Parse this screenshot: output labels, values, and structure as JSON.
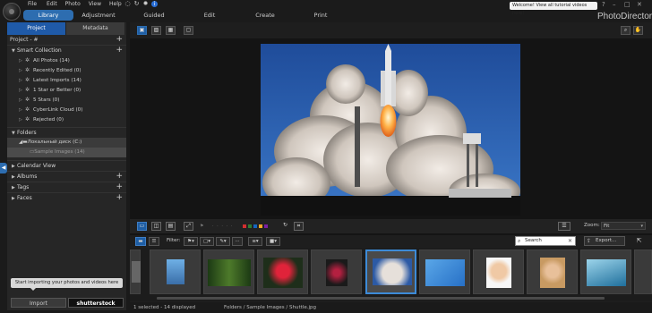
{
  "app": {
    "brand": "PhotoDirector",
    "welcome": "Welcome! View all tutorial videos here!"
  },
  "menu": [
    "File",
    "Edit",
    "Photo",
    "View",
    "Help"
  ],
  "modes": [
    {
      "label": "Library",
      "active": true
    },
    {
      "label": "Adjustment",
      "active": false
    },
    {
      "label": "Guided",
      "active": false
    },
    {
      "label": "Edit",
      "active": false
    },
    {
      "label": "Create",
      "active": false
    },
    {
      "label": "Print",
      "active": false
    }
  ],
  "sidebar": {
    "tabs": [
      {
        "label": "Project",
        "active": true
      },
      {
        "label": "Metadata",
        "active": false
      }
    ],
    "project": "Project - #",
    "smart_collection": {
      "title": "Smart Collection",
      "items": [
        "All Photos (14)",
        "Recently Edited (0)",
        "Latest Imports (14)",
        "1 Star or Better (0)",
        "5 Stars (0)",
        "CyberLink Cloud (0)",
        "Rejected (0)"
      ]
    },
    "folders": {
      "title": "Folders",
      "drive": "Локальный диск (C:)",
      "subfolder": "Sample Images (14)"
    },
    "sections": [
      "Calendar View",
      "Albums",
      "Tags",
      "Faces"
    ],
    "tooltip": "Start importing your photos and videos here",
    "import_label": "Import",
    "shutterstock_label": "shutterstock"
  },
  "viewer": {
    "photo_name": "rocket launch"
  },
  "toolbar": {
    "zoom_label": "Zoom:",
    "zoom_value": "Fit",
    "colors": [
      "#d32f2f",
      "#2e7d32",
      "#1565c0",
      "#f9a825",
      "#7b1fa2"
    ]
  },
  "filter": {
    "label": "Filter:",
    "search_placeholder": "Search",
    "export_label": "Export..."
  },
  "status": {
    "selected": "1 selected - 14 displayed",
    "path": "Folders / Sample Images / Shuttle.jpg"
  }
}
